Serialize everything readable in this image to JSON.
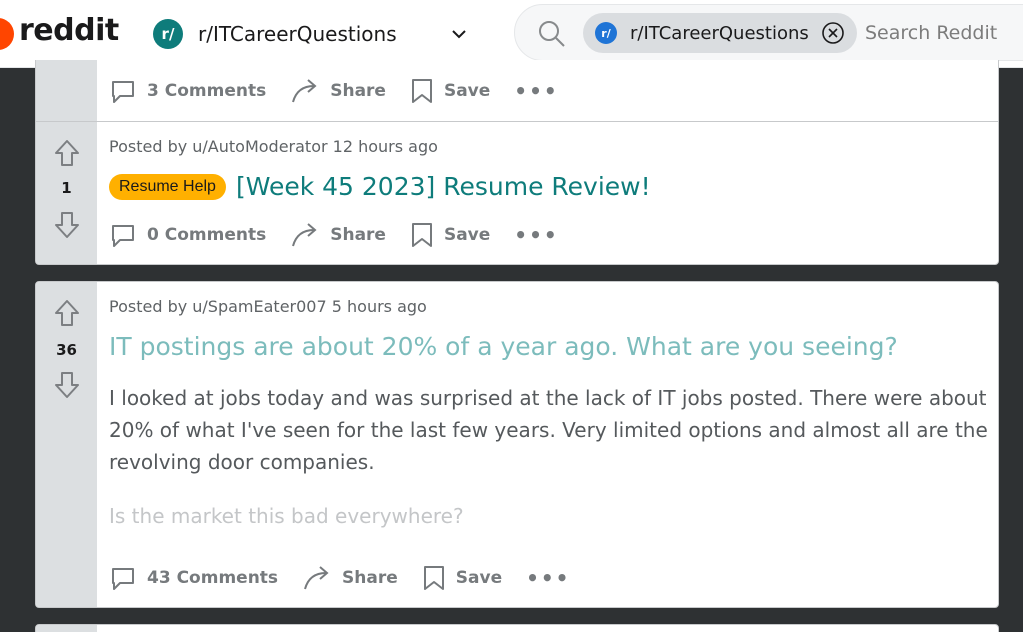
{
  "header": {
    "logo_text": "reddit",
    "subreddit_badge": "r/",
    "subreddit_name": "r/ITCareerQuestions",
    "search_chip_badge": "r/",
    "search_chip_label": "r/ITCareerQuestions",
    "search_placeholder": "Search Reddit"
  },
  "posts": [
    {
      "comments_label": "3 Comments",
      "share_label": "Share",
      "save_label": "Save",
      "more_label": "•••"
    },
    {
      "score": "1",
      "meta": "Posted by u/AutoModerator 12 hours ago",
      "flair": "Resume Help",
      "title": "[Week 45 2023] Resume Review!",
      "comments_label": "0 Comments",
      "share_label": "Share",
      "save_label": "Save",
      "more_label": "•••"
    },
    {
      "score": "36",
      "meta": "Posted by u/SpamEater007 5 hours ago",
      "title": "IT postings are about 20% of a year ago. What are you seeing?",
      "body_line1": "I looked at jobs today and was surprised at the lack of IT jobs posted. There were about",
      "body_line2": "20% of what I've seen for the last few years. Very limited options and almost all are the",
      "body_line3": "revolving door companies.",
      "body_faded": "Is the market this bad everywhere?",
      "comments_label": "43 Comments",
      "share_label": "Share",
      "save_label": "Save",
      "more_label": "•••"
    }
  ],
  "colors": {
    "brand": "#ff4500",
    "title_link": "#0e7c7b",
    "flair": "#ffb000"
  }
}
